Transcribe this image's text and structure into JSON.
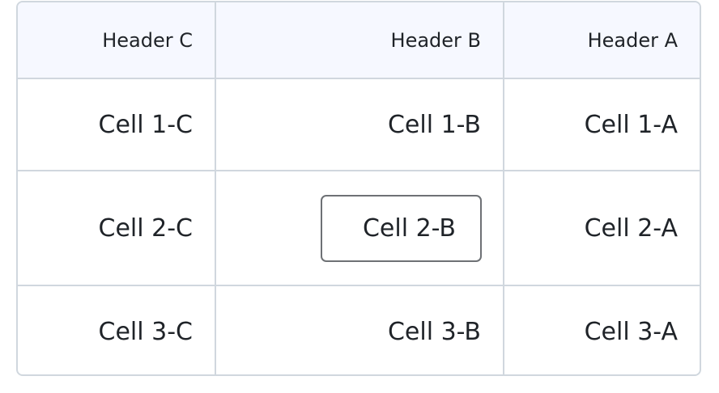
{
  "table": {
    "headers": [
      "Header C",
      "Header B",
      "Header A"
    ],
    "rows": [
      [
        "Cell 1-C",
        "Cell 1-B",
        "Cell 1-A"
      ],
      [
        "Cell 2-C",
        "Cell 2-B",
        "Cell 2-A"
      ],
      [
        "Cell 3-C",
        "Cell 3-B",
        "Cell 3-A"
      ]
    ],
    "active_cell": "Cell 2-B"
  }
}
